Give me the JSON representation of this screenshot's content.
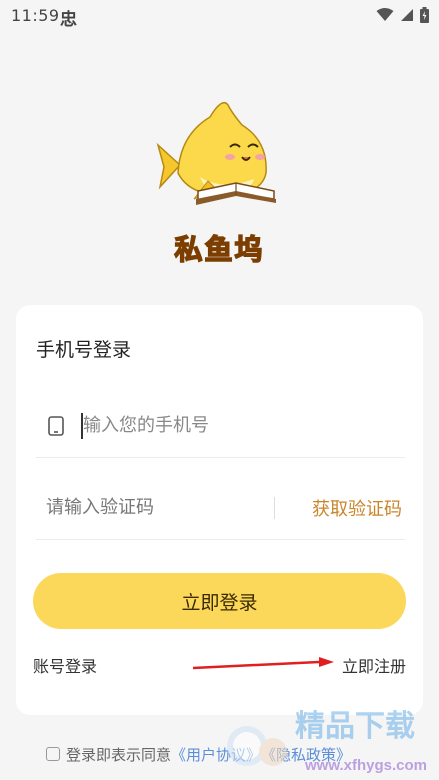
{
  "status_bar": {
    "time": "11:59",
    "extra_glyph": "忠"
  },
  "app": {
    "name": "私鱼坞",
    "logo": "shark-reading-book-logo"
  },
  "login_card": {
    "title": "手机号登录",
    "phone_placeholder": "输入您的手机号",
    "phone_value": "",
    "code_placeholder": "请输入验证码",
    "code_value": "",
    "get_code_label": "获取验证码",
    "login_button_label": "立即登录",
    "account_login_label": "账号登录",
    "register_label": "立即注册"
  },
  "agreement": {
    "prefix": "登录即表示同意",
    "user_agreement": "《用户协议》",
    "privacy_policy": "《隐私政策》"
  },
  "watermark": {
    "site_name": "精品下载",
    "site_url": "www.xfhygs.com"
  },
  "colors": {
    "accent": "#fbd75a",
    "get_code": "#c9862b",
    "link": "#5a8fd8",
    "annotation_arrow": "#e02020"
  }
}
